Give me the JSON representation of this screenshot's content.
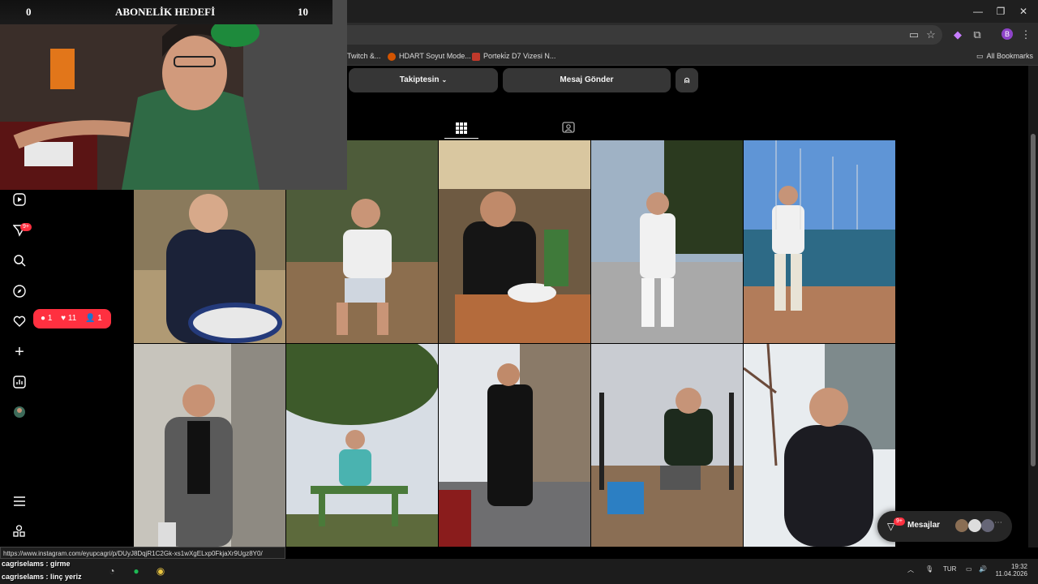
{
  "overlay": {
    "goal_left": "0",
    "goal_title": "ABONELİK HEDEFİ",
    "goal_right": "10"
  },
  "browser": {
    "bookmarks": [
      "Twitch &...",
      "HDART Soyut Mode...",
      "Porteki̇z D7 Vizesi N..."
    ],
    "all_bookmarks": "All Bookmarks",
    "profile_initial": "B"
  },
  "profile": {
    "following_button": "Takiptesin",
    "message_button": "Mesaj Gönder"
  },
  "notifications": {
    "nav_badge": "9+",
    "comments": "1",
    "likes": "11",
    "follows": "1"
  },
  "messages": {
    "label": "Mesajlar",
    "badge": "9+"
  },
  "status": {
    "url": "https://www.instagram.com/eyupcagri/p/DUyJ8DqjR1C2Gk-xs1wXgELxp0FkjaXr9Ugz8Y0/"
  },
  "chat": [
    {
      "user": "cagriselams",
      "text": "girme"
    },
    {
      "user": "cagriselams",
      "text": "linç yeriz"
    }
  ],
  "tray": {
    "lang": "TUR",
    "time": "19:32",
    "date": "11.04.2026"
  },
  "colors": {
    "accent": "#ff3040",
    "page_bg": "#000000",
    "button_bg": "#363636"
  }
}
